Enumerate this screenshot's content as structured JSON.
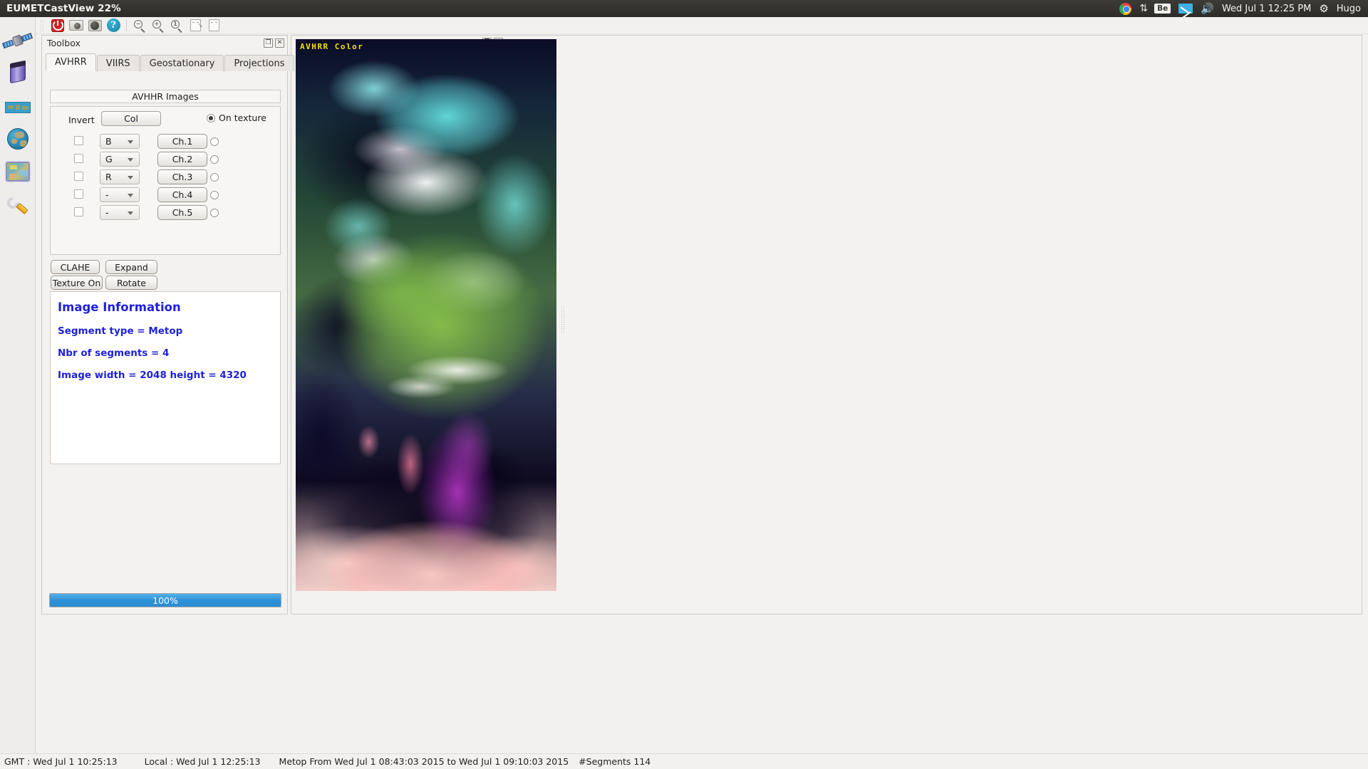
{
  "panel": {
    "title": "EUMETCastView 22%",
    "tray": {
      "chrome_icon": "chrome-icon",
      "network_icon": "network-arrows-icon",
      "input_badge": "Be",
      "mail_icon": "mail-icon",
      "volume_icon": "volume-icon",
      "clock": "Wed Jul  1 12:25 PM",
      "session_icon": "gear-icon",
      "user": "Hugo"
    }
  },
  "launcher": {
    "items": [
      {
        "name": "satellite-icon"
      },
      {
        "name": "satellite-cylinder-icon"
      },
      {
        "name": "world-strip-icon"
      },
      {
        "name": "globe-icon"
      },
      {
        "name": "map-icon"
      },
      {
        "name": "wrench-icon"
      }
    ]
  },
  "toolbar": {
    "buttons": [
      {
        "name": "power-button",
        "icon": "power-icon"
      },
      {
        "name": "camera-button",
        "icon": "camera-icon"
      },
      {
        "name": "globe-button",
        "icon": "globe-icon"
      },
      {
        "name": "help-button",
        "icon": "help-icon"
      },
      {
        "name": "zoom-out-button",
        "icon": "magnifier-minus-icon"
      },
      {
        "name": "zoom-in-button",
        "icon": "magnifier-plus-icon"
      },
      {
        "name": "zoom-actual-button",
        "icon": "magnifier-one-icon"
      },
      {
        "name": "fit-height-button",
        "icon": "page-fit-height-icon"
      },
      {
        "name": "fit-width-button",
        "icon": "page-fit-width-icon"
      }
    ],
    "zoom_one_label": "1"
  },
  "toolbox": {
    "title": "Toolbox",
    "float_label": "❐",
    "close_label": "✕",
    "tabs": [
      {
        "label": "AVHRR",
        "active": true
      },
      {
        "label": "VIIRS",
        "active": false
      },
      {
        "label": "Geostationary",
        "active": false
      },
      {
        "label": "Projections",
        "active": false
      }
    ],
    "images_header": "AVHHR Images",
    "invert_label": "Invert",
    "col_button": "Col",
    "on_texture_label": "On texture",
    "channels": [
      {
        "channel": "Ch.1",
        "color": "B",
        "invert": false,
        "selected": false
      },
      {
        "channel": "Ch.2",
        "color": "G",
        "invert": false,
        "selected": false
      },
      {
        "channel": "Ch.3",
        "color": "R",
        "invert": false,
        "selected": false
      },
      {
        "channel": "Ch.4",
        "color": "-",
        "invert": false,
        "selected": false
      },
      {
        "channel": "Ch.5",
        "color": "-",
        "invert": false,
        "selected": false
      }
    ],
    "actions": {
      "clahe": "CLAHE",
      "expand": "Expand",
      "texture": "Texture On",
      "rotate": "Rotate"
    },
    "info": {
      "title": "Image Information",
      "segment_type": "Segment type = Metop",
      "nbr_segments": "Nbr of segments = 4",
      "dimensions": "Image width = 2048 height = 4320"
    },
    "progress": {
      "label": "100%",
      "value": 100,
      "color": "#2d92d8"
    }
  },
  "imageview": {
    "float_label": "❐",
    "close_label": "✕",
    "overlay_label": "AVHRR Color"
  },
  "statusbar": {
    "gmt": "GMT : Wed Jul  1 10:25:13",
    "local": "Local : Wed Jul  1 12:25:13",
    "metadata": "Metop From Wed Jul 1 08:43:03 2015 to Wed Jul 1 09:10:03 2015",
    "segments": "#Segments 114"
  }
}
